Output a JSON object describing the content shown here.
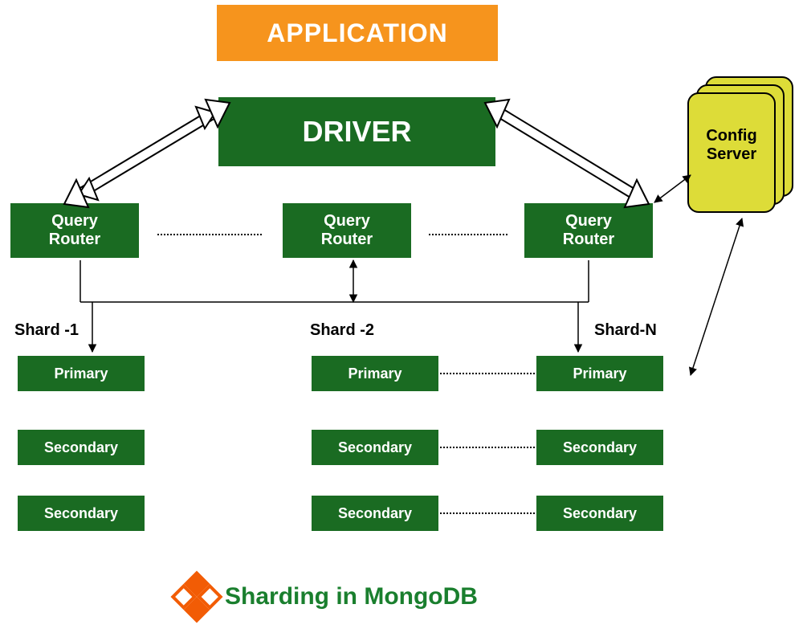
{
  "colors": {
    "application_bg": "#f6941d",
    "driver_bg": "#1a6b22",
    "config_bg": "#dddc38",
    "caption_green": "#1a7f2e",
    "logo_orange": "#f25c05"
  },
  "application": {
    "label": "APPLICATION"
  },
  "driver": {
    "label": "DRIVER"
  },
  "query_routers": [
    {
      "label": "Query\nRouter"
    },
    {
      "label": "Query\nRouter"
    },
    {
      "label": "Query\nRouter"
    }
  ],
  "config_server": {
    "line1": "Config",
    "line2": "Server"
  },
  "shards": [
    {
      "label": "Shard -1",
      "nodes": [
        {
          "role": "Primary"
        },
        {
          "role": "Secondary"
        },
        {
          "role": "Secondary"
        }
      ]
    },
    {
      "label": "Shard -2",
      "nodes": [
        {
          "role": "Primary"
        },
        {
          "role": "Secondary"
        },
        {
          "role": "Secondary"
        }
      ]
    },
    {
      "label": "Shard-N",
      "nodes": [
        {
          "role": "Primary"
        },
        {
          "role": "Secondary"
        },
        {
          "role": "Secondary"
        }
      ]
    }
  ],
  "caption": "Sharding in MongoDB",
  "icons": {
    "logo": "geeksforgeeks-logo"
  }
}
